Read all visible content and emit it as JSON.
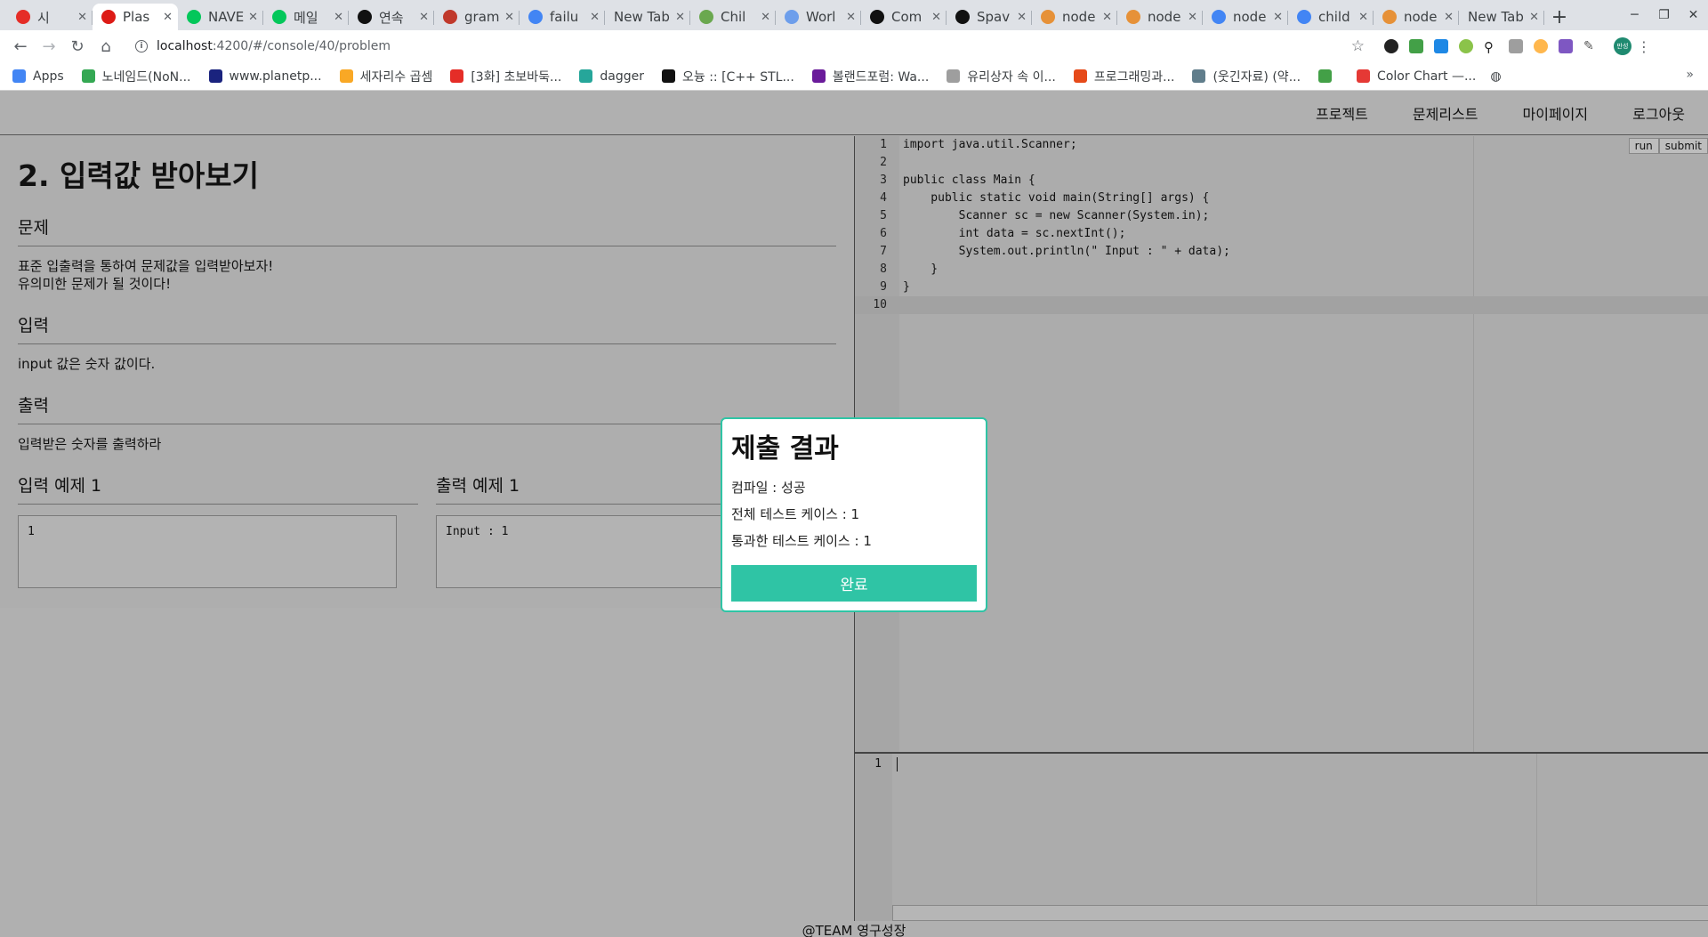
{
  "browser": {
    "tabs": [
      {
        "label": "시",
        "color": "#e52d27",
        "active": false
      },
      {
        "label": "Plas",
        "color": "#dd1b16",
        "active": true
      },
      {
        "label": "NAVE",
        "color": "#03c75a",
        "active": false
      },
      {
        "label": "메일",
        "color": "#03c75a",
        "active": false
      },
      {
        "label": "연속",
        "color": "#111111",
        "active": false
      },
      {
        "label": "gram",
        "color": "#c0392b",
        "active": false
      },
      {
        "label": "failu",
        "color": "#4285f4",
        "active": false
      },
      {
        "label": "New Tab",
        "color": "",
        "active": false
      },
      {
        "label": "Chil",
        "color": "#6aa84f",
        "active": false
      },
      {
        "label": "Worl",
        "color": "#6d9eeb",
        "active": false
      },
      {
        "label": "Com",
        "color": "#111111",
        "active": false
      },
      {
        "label": "Spav",
        "color": "#111111",
        "active": false
      },
      {
        "label": "node",
        "color": "#e69138",
        "active": false
      },
      {
        "label": "node",
        "color": "#e69138",
        "active": false
      },
      {
        "label": "node",
        "color": "#4285f4",
        "active": false
      },
      {
        "label": "child",
        "color": "#4285f4",
        "active": false
      },
      {
        "label": "node",
        "color": "#e69138",
        "active": false
      },
      {
        "label": "New Tab",
        "color": "",
        "active": false
      }
    ],
    "url_host": "localhost",
    "url_path": ":4200/#/console/40/problem",
    "bookmarks": [
      {
        "label": "Apps",
        "color": "#4285f4"
      },
      {
        "label": "노네임드(NoN...",
        "color": "#34a853"
      },
      {
        "label": "www.planetp...",
        "color": "#1a237e"
      },
      {
        "label": "세자리수 곱셈",
        "color": "#f9a825"
      },
      {
        "label": "[3화] 초보바둑...",
        "color": "#e52d27"
      },
      {
        "label": "dagger",
        "color": "#26a69a"
      },
      {
        "label": "오늉 :: [C++ STL...",
        "color": "#111111"
      },
      {
        "label": "볼랜드포럼: Wa...",
        "color": "#6a1b9a"
      },
      {
        "label": "유리상자 속 이...",
        "color": "#9e9e9e"
      },
      {
        "label": "프로그래밍과...",
        "color": "#e64a19"
      },
      {
        "label": "(웃긴자료) (약...",
        "color": "#607d8b"
      },
      {
        "label": "",
        "color": "#43a047"
      },
      {
        "label": "Color Chart —...",
        "color": "#e53935"
      }
    ],
    "profile_label": "만성"
  },
  "nav": {
    "project": "프로젝트",
    "problems": "문제리스트",
    "mypage": "마이페이지",
    "logout": "로그아웃"
  },
  "problem": {
    "title": "2. 입력값 받아보기",
    "section_problem": "문제",
    "problem_text_1": "표준 입출력을 통하여 문제값을 입력받아보자!",
    "problem_text_2": "유의미한 문제가 될 것이다!",
    "section_input": "입력",
    "input_text": "input 값은 숫자 값이다.",
    "section_output": "출력",
    "output_text": "입력받은 숫자를 출력하라",
    "example_input_title": "입력 예제 1",
    "example_input": "1",
    "example_output_title": "출력 예제 1",
    "example_output": "Input : 1"
  },
  "editor": {
    "run": "run",
    "submit": "submit",
    "lines": [
      {
        "n": "1",
        "code": "import java.util.Scanner;"
      },
      {
        "n": "2",
        "code": ""
      },
      {
        "n": "3",
        "code": "public class Main {"
      },
      {
        "n": "4",
        "code": "    public static void main(String[] args) {"
      },
      {
        "n": "5",
        "code": "        Scanner sc = new Scanner(System.in);"
      },
      {
        "n": "6",
        "code": "        int data = sc.nextInt();"
      },
      {
        "n": "7",
        "code": "        System.out.println(\" Input : \" + data);"
      },
      {
        "n": "8",
        "code": "    }"
      },
      {
        "n": "9",
        "code": "}"
      },
      {
        "n": "10",
        "code": ""
      }
    ],
    "current_line": 9
  },
  "console": {
    "line": "1"
  },
  "footer": "@TEAM 영구성장",
  "modal": {
    "title": "제출 결과",
    "compile": "컴파일 : 성공",
    "total": "전체 테스트 케이스 : 1",
    "passed": "통과한 테스트 케이스 : 1",
    "confirm": "완료",
    "accent": "#2fc4a5"
  }
}
